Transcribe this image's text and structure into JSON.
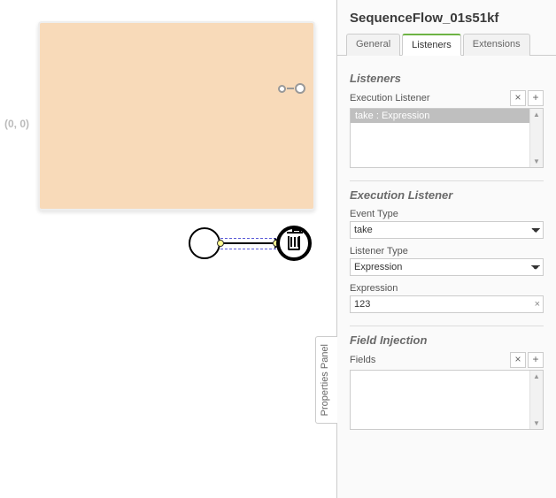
{
  "canvas": {
    "coord_label": "(0, 0)"
  },
  "panel": {
    "collapse_tab": "Properties Panel",
    "title": "SequenceFlow_01s51kf",
    "tabs": [
      {
        "label": "General",
        "active": false
      },
      {
        "label": "Listeners",
        "active": true
      },
      {
        "label": "Extensions",
        "active": false
      }
    ],
    "listeners": {
      "group_title": "Listeners",
      "list_label": "Execution Listener",
      "items": [
        {
          "display": "take : Expression"
        }
      ],
      "x_icon": "×",
      "plus_icon": "+"
    },
    "exec_listener": {
      "group_title": "Execution Listener",
      "event_type_label": "Event Type",
      "event_type_value": "take",
      "listener_type_label": "Listener Type",
      "listener_type_value": "Expression",
      "expression_label": "Expression",
      "expression_value": "123",
      "clear_icon": "×"
    },
    "field_injection": {
      "group_title": "Field Injection",
      "list_label": "Fields",
      "x_icon": "×",
      "plus_icon": "+"
    }
  }
}
